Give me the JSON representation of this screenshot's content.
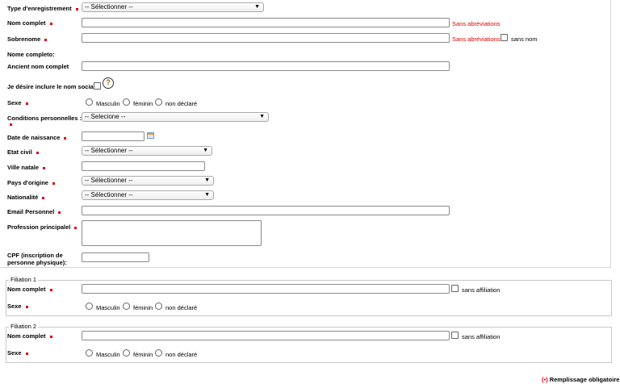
{
  "form": {
    "type_label": "Type d'enregistrement",
    "type_select": "-- Sélectionner --",
    "nom_label": "Nom complet",
    "nom_note": "Sans abréviations",
    "sobrenome_label": "Sobrenome",
    "sobrenome_note": "Sans abréviations",
    "sans_nom": "sans nom",
    "nome_completo_label": "Nome completo:",
    "ancien_label": "Ancient nom complet",
    "nom_sociale_label": "Je désire inclure le nom sociale",
    "help_glyph": "?",
    "sexe_label": "Sexe",
    "masculin": "Masculin",
    "feminin": "féminin",
    "non_declare": "non déclaré",
    "conditions_label": "Conditions personnelles :",
    "conditions_select": "-- Selecione --",
    "naissance_label": "Date de naissance",
    "etat_label": "Etat civil",
    "etat_select": "-- Sélectionner --",
    "ville_label": "Ville natale",
    "pays_label": "Pays d'origine",
    "pays_select": "-- Sélectionner --",
    "nationalite_label": "Nationalité",
    "nationalite_select": "-- Sélectionner --",
    "email_label": "Email Personnel",
    "profession_label": "Profession principalel",
    "cpf_label_1": "CPF (inscription de",
    "cpf_label_2": "personne physique):"
  },
  "filiation1": {
    "legend": "Filiation 1",
    "nom_label": "Nom complet",
    "sans_affiliation": "sans affiliation",
    "sexe_label": "Sexe",
    "masculin": "Masculin",
    "feminin": "féminin",
    "non_declare": "non déclaré"
  },
  "filiation2": {
    "legend": "Filiation 2",
    "nom_label": "Nom complet",
    "sans_affiliation": "sans affiliation",
    "sexe_label": "Sexe",
    "masculin": "Masculin",
    "feminin": "féminin",
    "non_declare": "non déclaré"
  },
  "footer": {
    "marker": "(•)",
    "text": "Remplissage obligatoire"
  },
  "colors": {
    "required": "#e00000",
    "border": "#8a8a8a"
  }
}
